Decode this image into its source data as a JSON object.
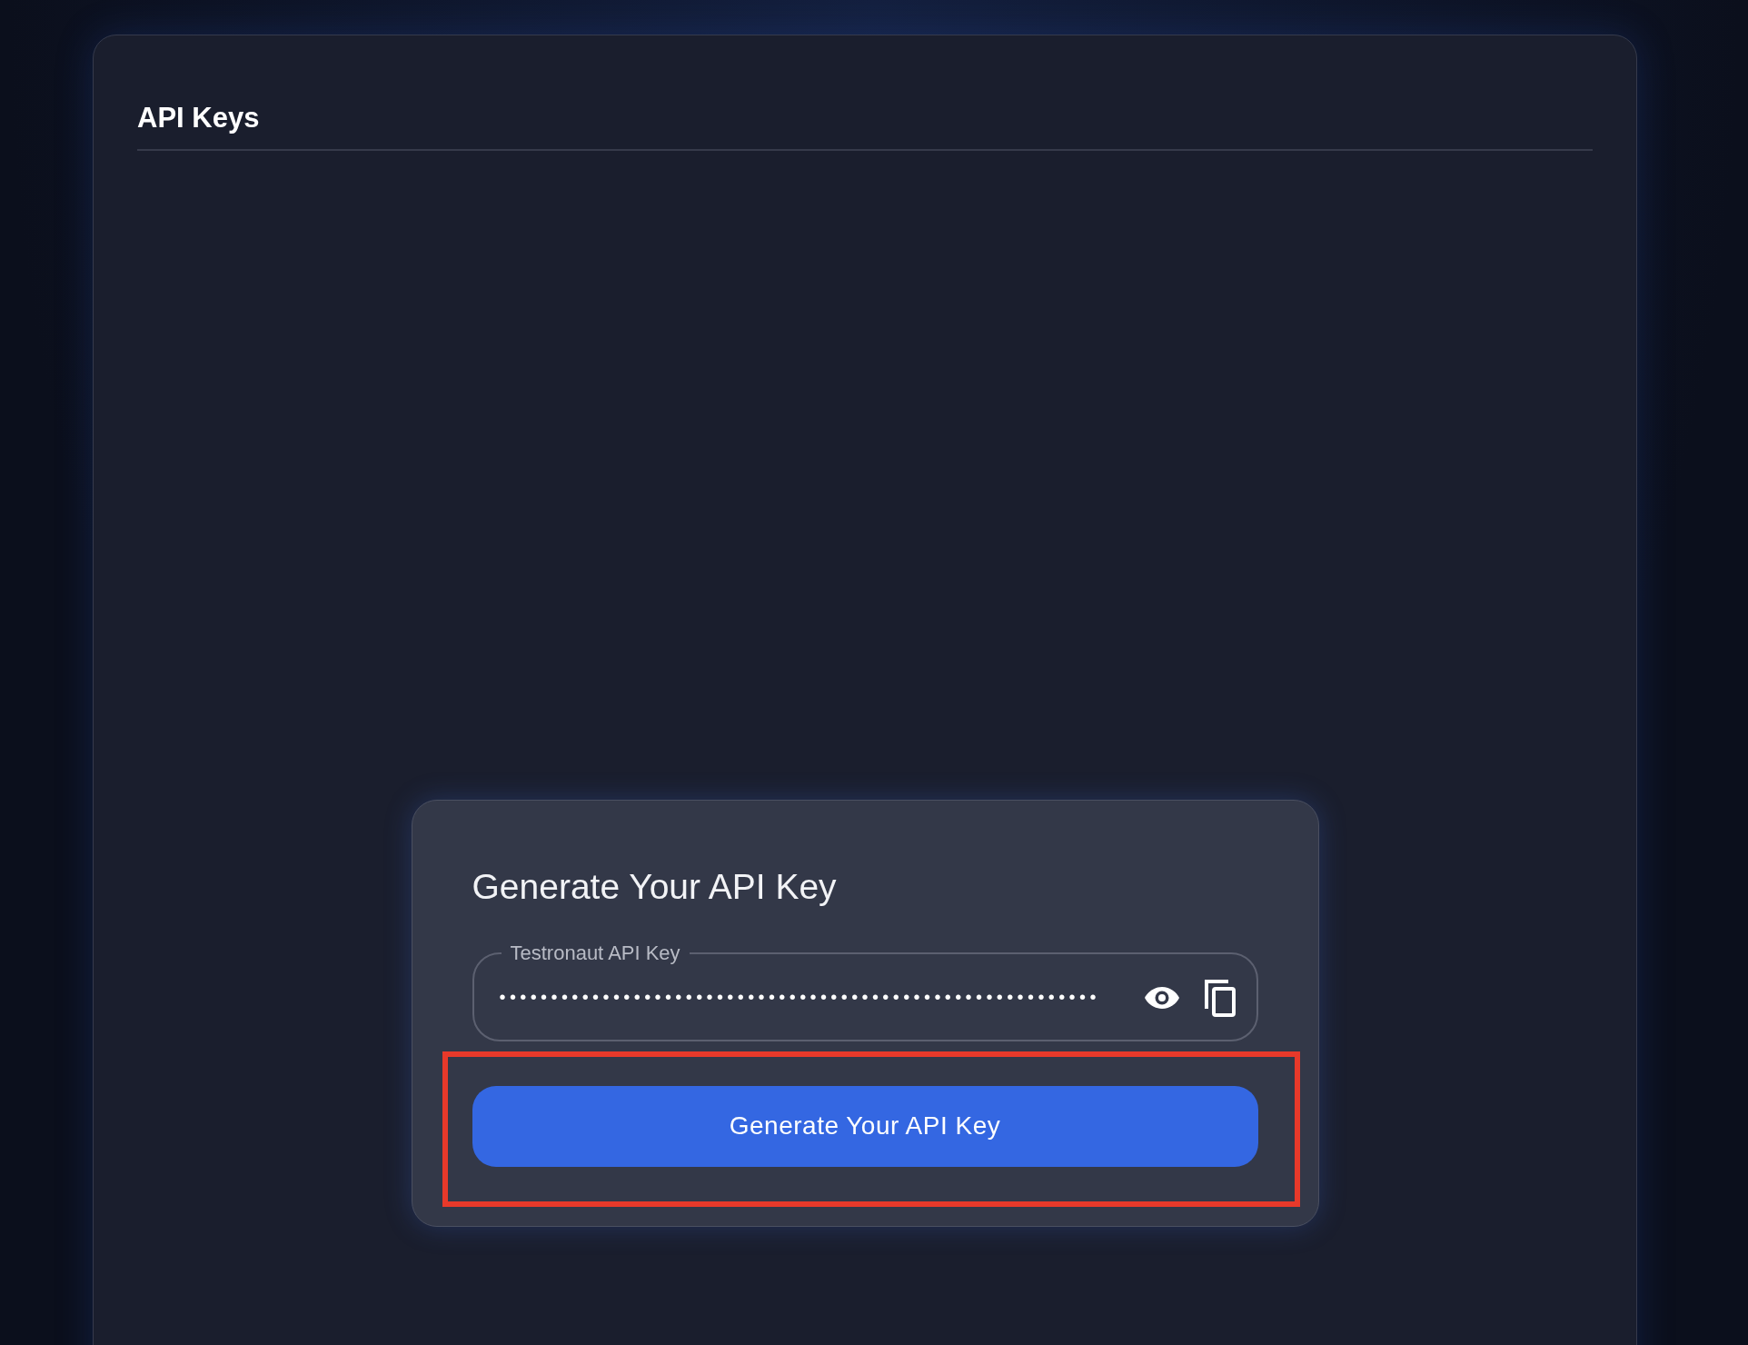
{
  "panel": {
    "title": "API Keys"
  },
  "card": {
    "heading": "Generate Your API Key",
    "key_field": {
      "label": "Testronaut API Key",
      "value": "••••••••••••••••••••••••••••••••••••••••••••••••••••••••••"
    },
    "generate_button": {
      "label": "Generate Your API Key",
      "highlighted": true
    }
  }
}
